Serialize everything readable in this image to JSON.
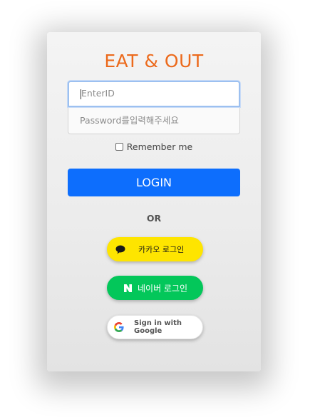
{
  "brand": {
    "title": "EAT & OUT"
  },
  "login_form": {
    "id_placeholder": "EnterID",
    "password_placeholder": "Password를입력해주세요",
    "remember_label": "Remember me",
    "login_label": "LOGIN"
  },
  "divider": {
    "label": "OR"
  },
  "social": {
    "kakao_label": "카카오 로그인",
    "naver_label": "네이버 로그인",
    "google_label": "Sign in with Google"
  },
  "colors": {
    "brand": "#ec6a1c",
    "primary": "#0d6efd",
    "kakao": "#fee500",
    "naver": "#03c75a"
  },
  "icons": [
    "kakao-chat-icon",
    "naver-n-icon",
    "google-g-icon"
  ]
}
